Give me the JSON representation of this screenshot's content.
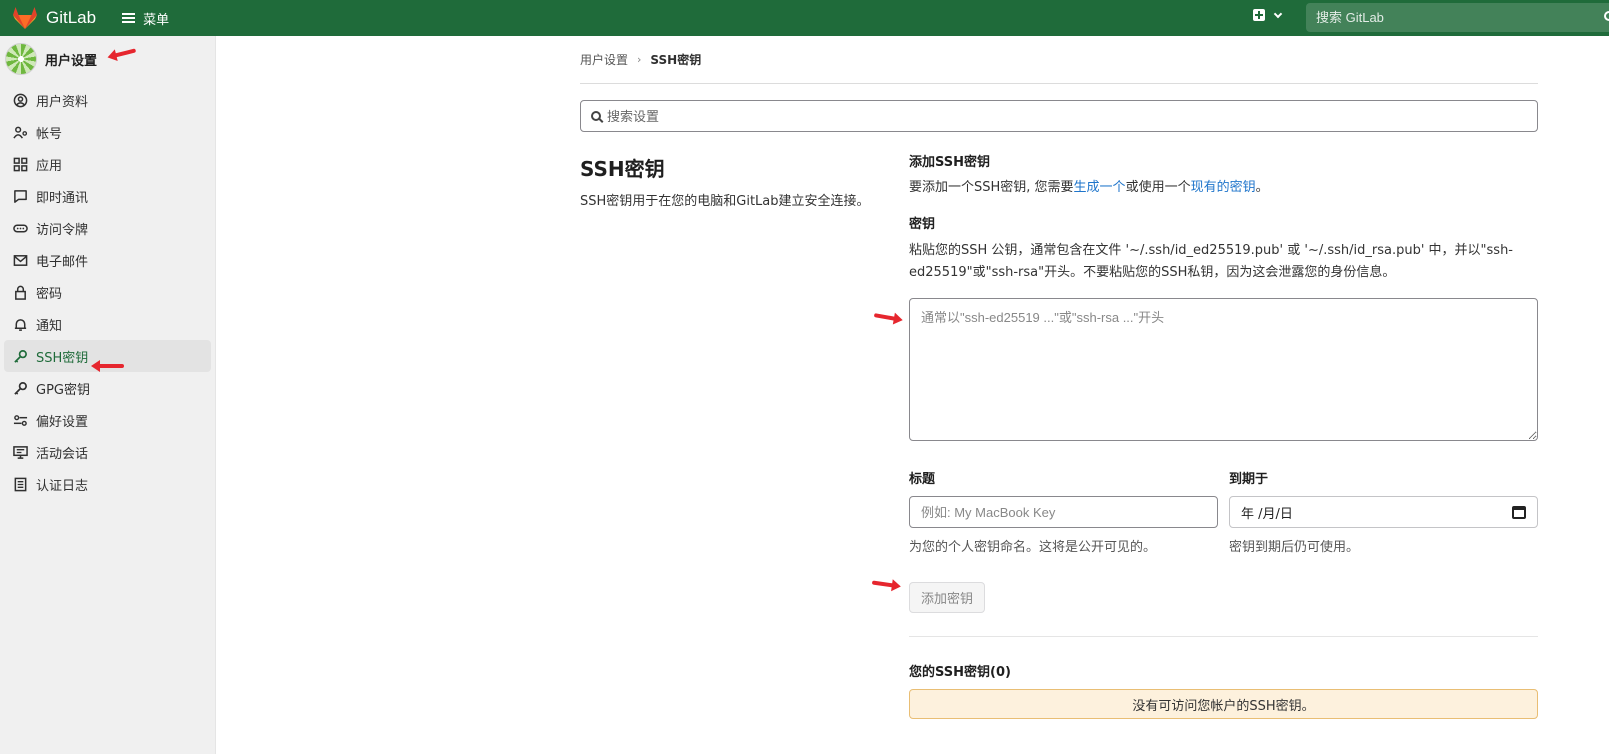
{
  "topbar": {
    "brand": "GitLab",
    "menu_label": "菜单",
    "search_placeholder": "搜索 GitLab"
  },
  "sidebar": {
    "title": "用户设置",
    "items": [
      {
        "label": "用户资料",
        "icon": "profile-icon"
      },
      {
        "label": "帐号",
        "icon": "account-icon"
      },
      {
        "label": "应用",
        "icon": "applications-icon"
      },
      {
        "label": "即时通讯",
        "icon": "chat-icon"
      },
      {
        "label": "访问令牌",
        "icon": "token-icon"
      },
      {
        "label": "电子邮件",
        "icon": "mail-icon"
      },
      {
        "label": "密码",
        "icon": "lock-icon"
      },
      {
        "label": "通知",
        "icon": "bell-icon"
      },
      {
        "label": "SSH密钥",
        "icon": "key-icon",
        "active": true
      },
      {
        "label": "GPG密钥",
        "icon": "key-icon"
      },
      {
        "label": "偏好设置",
        "icon": "preferences-icon"
      },
      {
        "label": "活动会话",
        "icon": "monitor-icon"
      },
      {
        "label": "认证日志",
        "icon": "log-icon"
      }
    ]
  },
  "breadcrumb": {
    "parent": "用户设置",
    "current": "SSH密钥"
  },
  "settings_search": {
    "placeholder": "搜索设置"
  },
  "section": {
    "title": "SSH密钥",
    "description": "SSH密钥用于在您的电脑和GitLab建立安全连接。"
  },
  "add_key": {
    "heading": "添加SSH密钥",
    "intro_before": "要添加一个SSH密钥, 您需要",
    "generate_link": "生成一个",
    "intro_middle": "或使用一个",
    "existing_link": "现有的密钥",
    "intro_after": "。",
    "key_label": "密钥",
    "key_help": "粘贴您的SSH 公钥，通常包含在文件 '~/.ssh/id_ed25519.pub' 或 '~/.ssh/id_rsa.pub' 中，并以\"ssh-ed25519\"或\"ssh-rsa\"开头。不要粘贴您的SSH私钥，因为这会泄露您的身份信息。",
    "key_placeholder": "通常以\"ssh-ed25519 ...\"或\"ssh-rsa ...\"开头",
    "title_label": "标题",
    "title_placeholder": "例如: My MacBook Key",
    "title_hint": "为您的个人密钥命名。这将是公开可见的。",
    "expires_label": "到期于",
    "expires_value": "年 /月/日",
    "expires_hint": "密钥到期后仍可使用。",
    "submit_label": "添加密钥"
  },
  "your_keys": {
    "title": "您的SSH密钥(0)",
    "empty_message": "没有可访问您帐户的SSH密钥。"
  },
  "colors": {
    "topbar": "#1f6b3a",
    "link": "#1f75cb",
    "annotation_arrow": "#e6262e",
    "alert_bg": "#fdf1dd"
  }
}
